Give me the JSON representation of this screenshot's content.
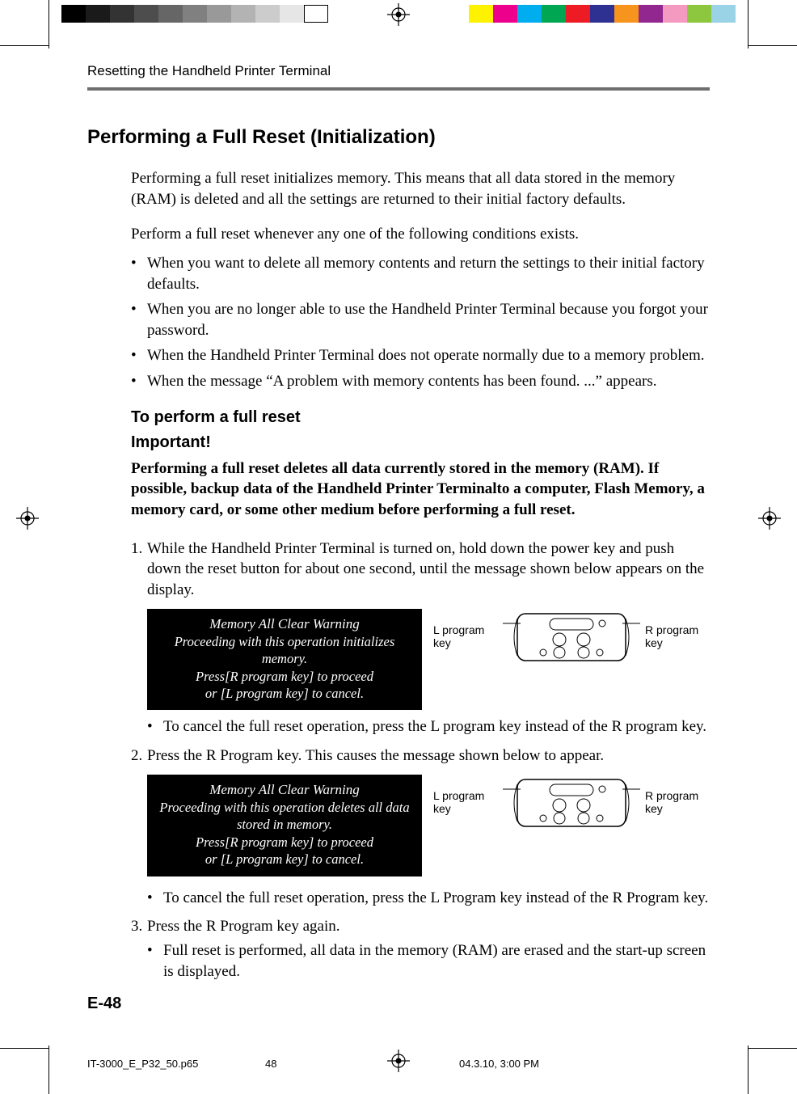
{
  "print_marks": {
    "left_swatches": [
      "#000000",
      "#1a1a1a",
      "#333333",
      "#4d4d4d",
      "#666666",
      "#808080",
      "#999999",
      "#b3b3b3",
      "#cccccc",
      "#e6e6e6",
      "#ffffff"
    ],
    "right_swatches": [
      "#fff200",
      "#ec008c",
      "#00aeef",
      "#00a651",
      "#ed1c24",
      "#2e3192",
      "#f7941d",
      "#92278f",
      "#f49ac1",
      "#8dc63f",
      "#9bd3e6"
    ]
  },
  "header": {
    "running_head": "Resetting the Handheld Printer Terminal"
  },
  "section": {
    "title": "Performing a Full Reset (Initialization)",
    "intro": "Performing a full reset initializes memory. This means that all data stored in the memory (RAM) is deleted and all the settings are returned to their initial factory defaults.",
    "lead": "Perform a full reset whenever any one of the following conditions exists.",
    "conditions": [
      "When you want to delete all memory contents and return the settings to their initial factory defaults.",
      "When you are no longer able to use the Handheld Printer Terminal because you forgot your password.",
      "When the Handheld Printer Terminal does not operate normally due to a memory problem.",
      "When the message “A problem with memory contents has been found. ...” appears."
    ],
    "subhead": "To perform a full reset",
    "important_label": "Important!",
    "important_text": "Performing a full reset deletes all data currently stored in the memory (RAM). If possible, backup data of the Handheld Printer Terminalto a computer, Flash Memory, a memory card, or some other medium before performing a full reset.",
    "steps": {
      "s1": "While the Handheld Printer Terminal is turned on, hold down the power key and push down the reset button for about one second, until the message shown below appears on the display.",
      "s1_note": "To cancel the full reset operation, press the L program key instead of the R program key.",
      "s2": "Press the R Program key. This causes the message shown below to appear.",
      "s2_note": "To cancel the full reset operation, press the L Program key instead of the R Program key.",
      "s3": "Press the R Program key again.",
      "s3_note": "Full reset is performed, all data in the memory (RAM) are erased and the start-up screen is displayed."
    },
    "lcd1": {
      "l1": "Memory All Clear Warning",
      "l2": "Proceeding with this operation initializes memory.",
      "l3": "Press[R program key]  to proceed",
      "l4": "or [L program key] to cancel."
    },
    "lcd2": {
      "l1": "Memory All Clear Warning",
      "l2": "Proceeding with this operation deletes all data",
      "l3": "stored in memory.",
      "l4": "Press[R program key]  to proceed",
      "l5": "or [L program key] to cancel."
    },
    "key_labels": {
      "left": "L program key",
      "right": "R program key"
    }
  },
  "page_number": "E-48",
  "slug": {
    "filename": "IT-3000_E_P32_50.p65",
    "page": "48",
    "timestamp": "04.3.10, 3:00 PM"
  }
}
